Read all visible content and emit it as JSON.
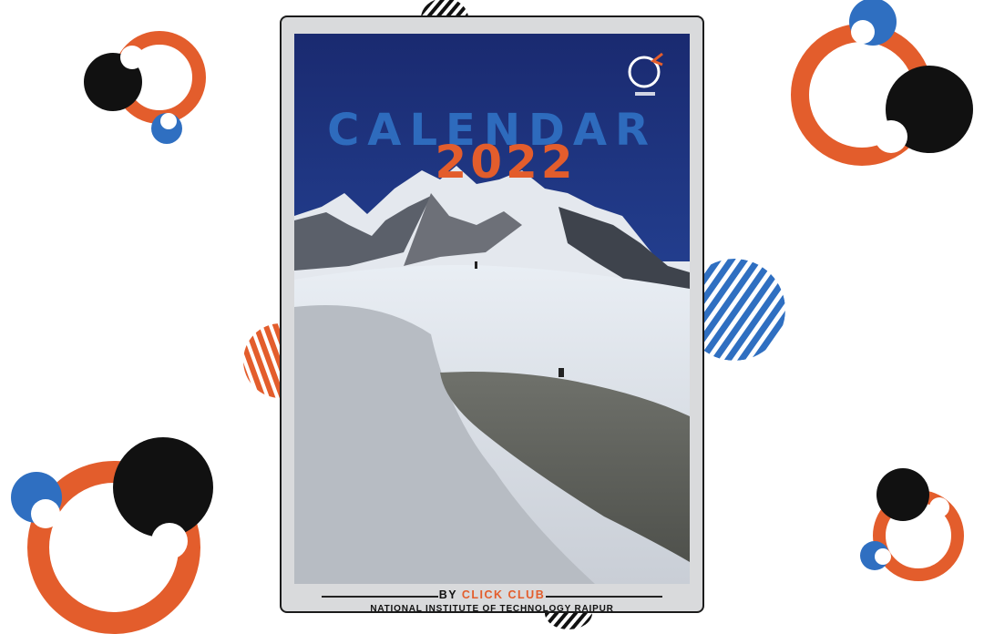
{
  "poster": {
    "title": "CALENDAR",
    "year": "2022",
    "by_prefix": "BY",
    "club_name": "CLICK CLUB",
    "institute": "NATIONAL INSTITUTE OF TECHNOLOGY RAIPUR",
    "logo_icon": "click-club-logo-icon"
  },
  "colors": {
    "orange": "#e35d2c",
    "blue": "#2f6fc1",
    "black": "#111111",
    "sky": "#1d2f7a"
  }
}
